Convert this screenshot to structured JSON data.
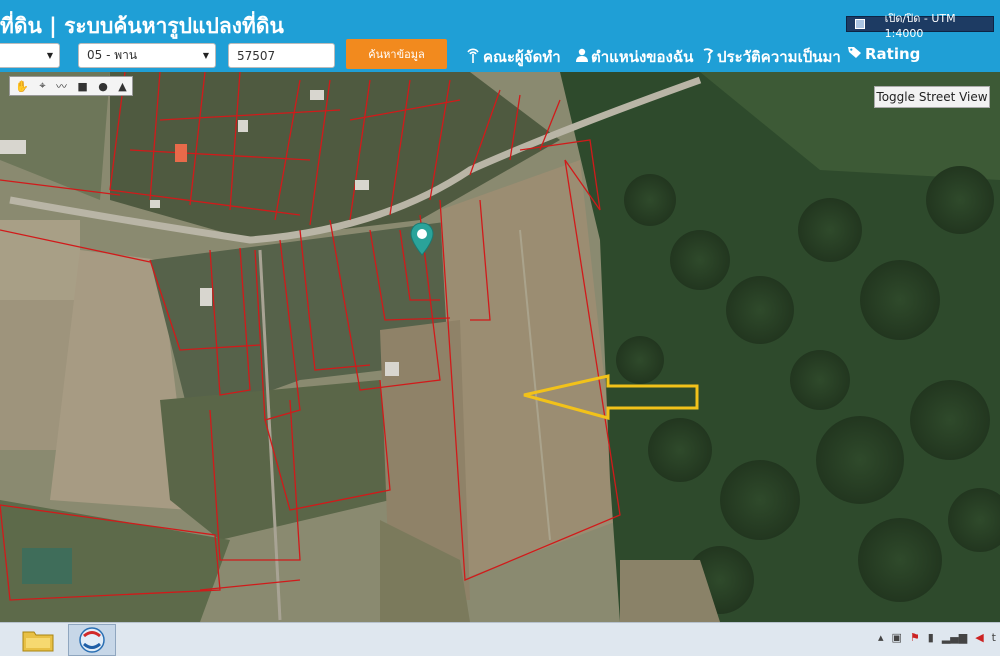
{
  "header": {
    "title": "ที่ดิน | ระบบค้นหารูปแปลงที่ดิน",
    "toggle_label": "เปิด/ปิด - UTM 1:4000",
    "select_1_value": "",
    "select_2_value": "05 - พาน",
    "parcel_input_value": "57507",
    "search_button": "ค้นหาข้อมูล",
    "nav": [
      {
        "icon": "wifi-antenna-icon",
        "label": "คณะผู้จัดทำ"
      },
      {
        "icon": "person-icon",
        "label": "ตำแหน่งของฉัน"
      },
      {
        "icon": "history-icon",
        "label": "ประวัติความเป็นมา"
      },
      {
        "icon": "tag-icon",
        "label": "Rating"
      }
    ]
  },
  "map": {
    "street_view_button": "Toggle Street View",
    "draw_tools": [
      "hand-icon",
      "marker-icon",
      "polyline-icon",
      "rectangle-icon",
      "circle-icon",
      "polygon-icon"
    ],
    "annotation_arrow_color": "#f2c21a",
    "parcel_line_color": "#d11a1a",
    "marker_color": "#2aa39a"
  },
  "taskbar": {
    "apps": [
      "folder-icon",
      "browser-icon"
    ],
    "tray": [
      "chevron-up-icon",
      "chat-icon",
      "flag-icon",
      "battery-icon",
      "signal-icon",
      "volume-icon",
      "ime-icon"
    ]
  }
}
